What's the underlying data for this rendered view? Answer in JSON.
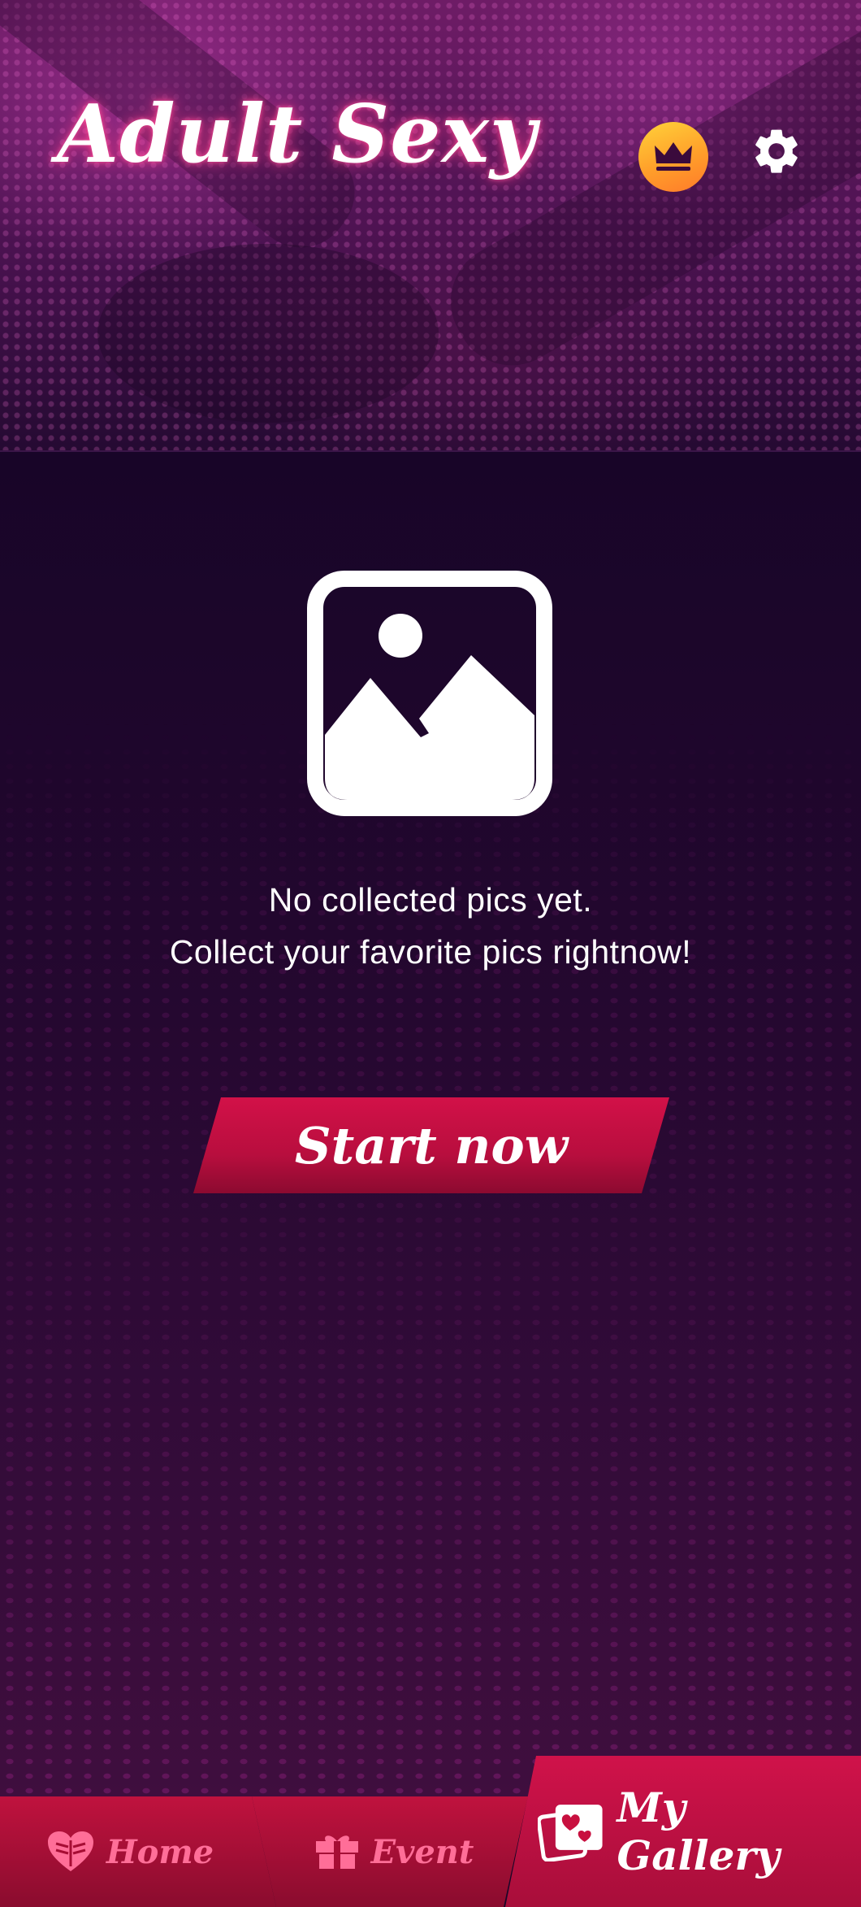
{
  "header": {
    "app_title": "Adult Sexy",
    "vip_icon": "crown-icon",
    "settings_icon": "gear-icon"
  },
  "main": {
    "empty_icon": "image-placeholder-icon",
    "empty_line1": "No collected pics yet.",
    "empty_line2": "Collect your favorite pics rightnow!",
    "start_button": "Start now"
  },
  "nav": {
    "home": {
      "label": "Home",
      "icon": "heart-book-icon"
    },
    "event": {
      "label": "Event",
      "icon": "gift-icon"
    },
    "gallery": {
      "label": "My Gallery",
      "icon": "photo-heart-icon",
      "active": true
    }
  },
  "colors": {
    "accent": "#c8103f",
    "inactive_label": "#ff6e98",
    "vip_gold": "#ffb52e",
    "background": "#1a0628"
  }
}
